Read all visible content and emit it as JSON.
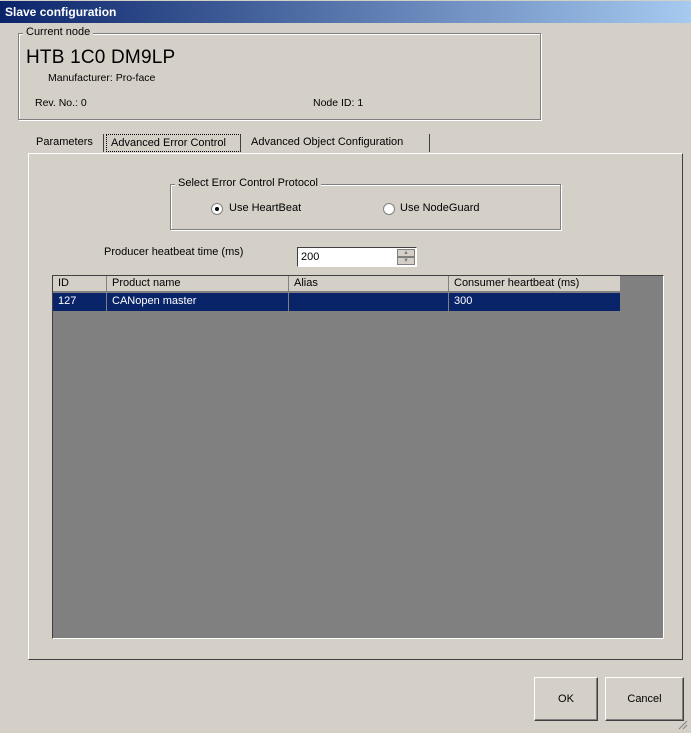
{
  "window": {
    "title": "Slave configuration"
  },
  "current_node": {
    "legend": "Current node",
    "name": "HTB 1C0 DM9LP",
    "manufacturer": "Manufacturer: Pro-face",
    "rev": "Rev. No.: 0",
    "node_id": "Node ID: 1"
  },
  "tabs": [
    {
      "label": "Parameters"
    },
    {
      "label": "Advanced Error Control"
    },
    {
      "label": "Advanced Object Configuration"
    }
  ],
  "protocol": {
    "legend": "Select Error Control Protocol",
    "heartbeat_label": "Use HeartBeat",
    "nodeguard_label": "Use NodeGuard",
    "selected": "heartbeat"
  },
  "producer": {
    "label": "Producer heatbeat time (ms)",
    "value": "200"
  },
  "table": {
    "columns": [
      "ID",
      "Product name",
      "Alias",
      "Consumer heartbeat (ms)"
    ],
    "rows": [
      {
        "id": "127",
        "product": "CANopen master",
        "alias": "",
        "consumer": "300"
      }
    ]
  },
  "buttons": {
    "ok": "OK",
    "cancel": "Cancel"
  },
  "colors": {
    "selection": "#0a246a",
    "face": "#d4d0c8",
    "grid_bg": "#808080"
  }
}
